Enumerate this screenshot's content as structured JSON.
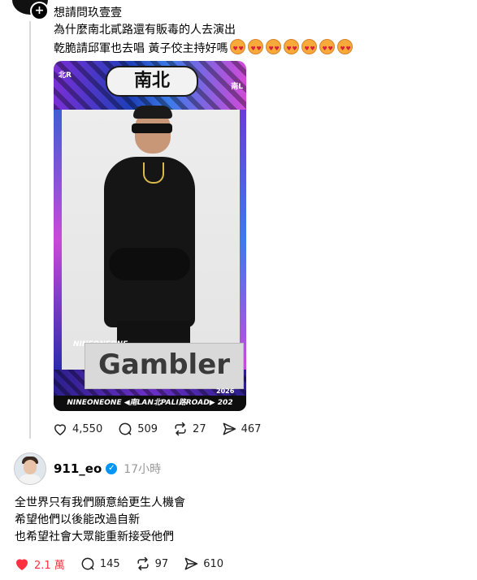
{
  "post": {
    "lines": [
      "想請問玖壹壹",
      "為什麼南北貳路還有販毒的人去演出",
      "乾脆請邱軍也去唱 黃子佼主持好嗎"
    ],
    "emoji_count": 7,
    "image": {
      "logo": "南北",
      "tag_left": "北R",
      "tag_right": "南L",
      "caption_top": "NINEONEONE",
      "name_card": "Gambler",
      "year": "2026",
      "bottom_strip": "NINEONEONE ◀南LAN北PALI路ROAD▶ 202"
    },
    "stats": {
      "likes": "4,550",
      "comments": "509",
      "reposts": "27",
      "shares": "467"
    }
  },
  "reply": {
    "username": "911_eo",
    "time": "17小時",
    "lines": [
      "全世界只有我們願意給更生人機會",
      "希望他們以後能改過自新",
      "也希望社會大眾能重新接受他們"
    ],
    "stats": {
      "likes": "2.1 萬",
      "comments": "145",
      "reposts": "97",
      "shares": "610"
    }
  },
  "colors": {
    "like_red": "#ff3040",
    "verified_blue": "#0095f6",
    "muted": "#999999"
  }
}
